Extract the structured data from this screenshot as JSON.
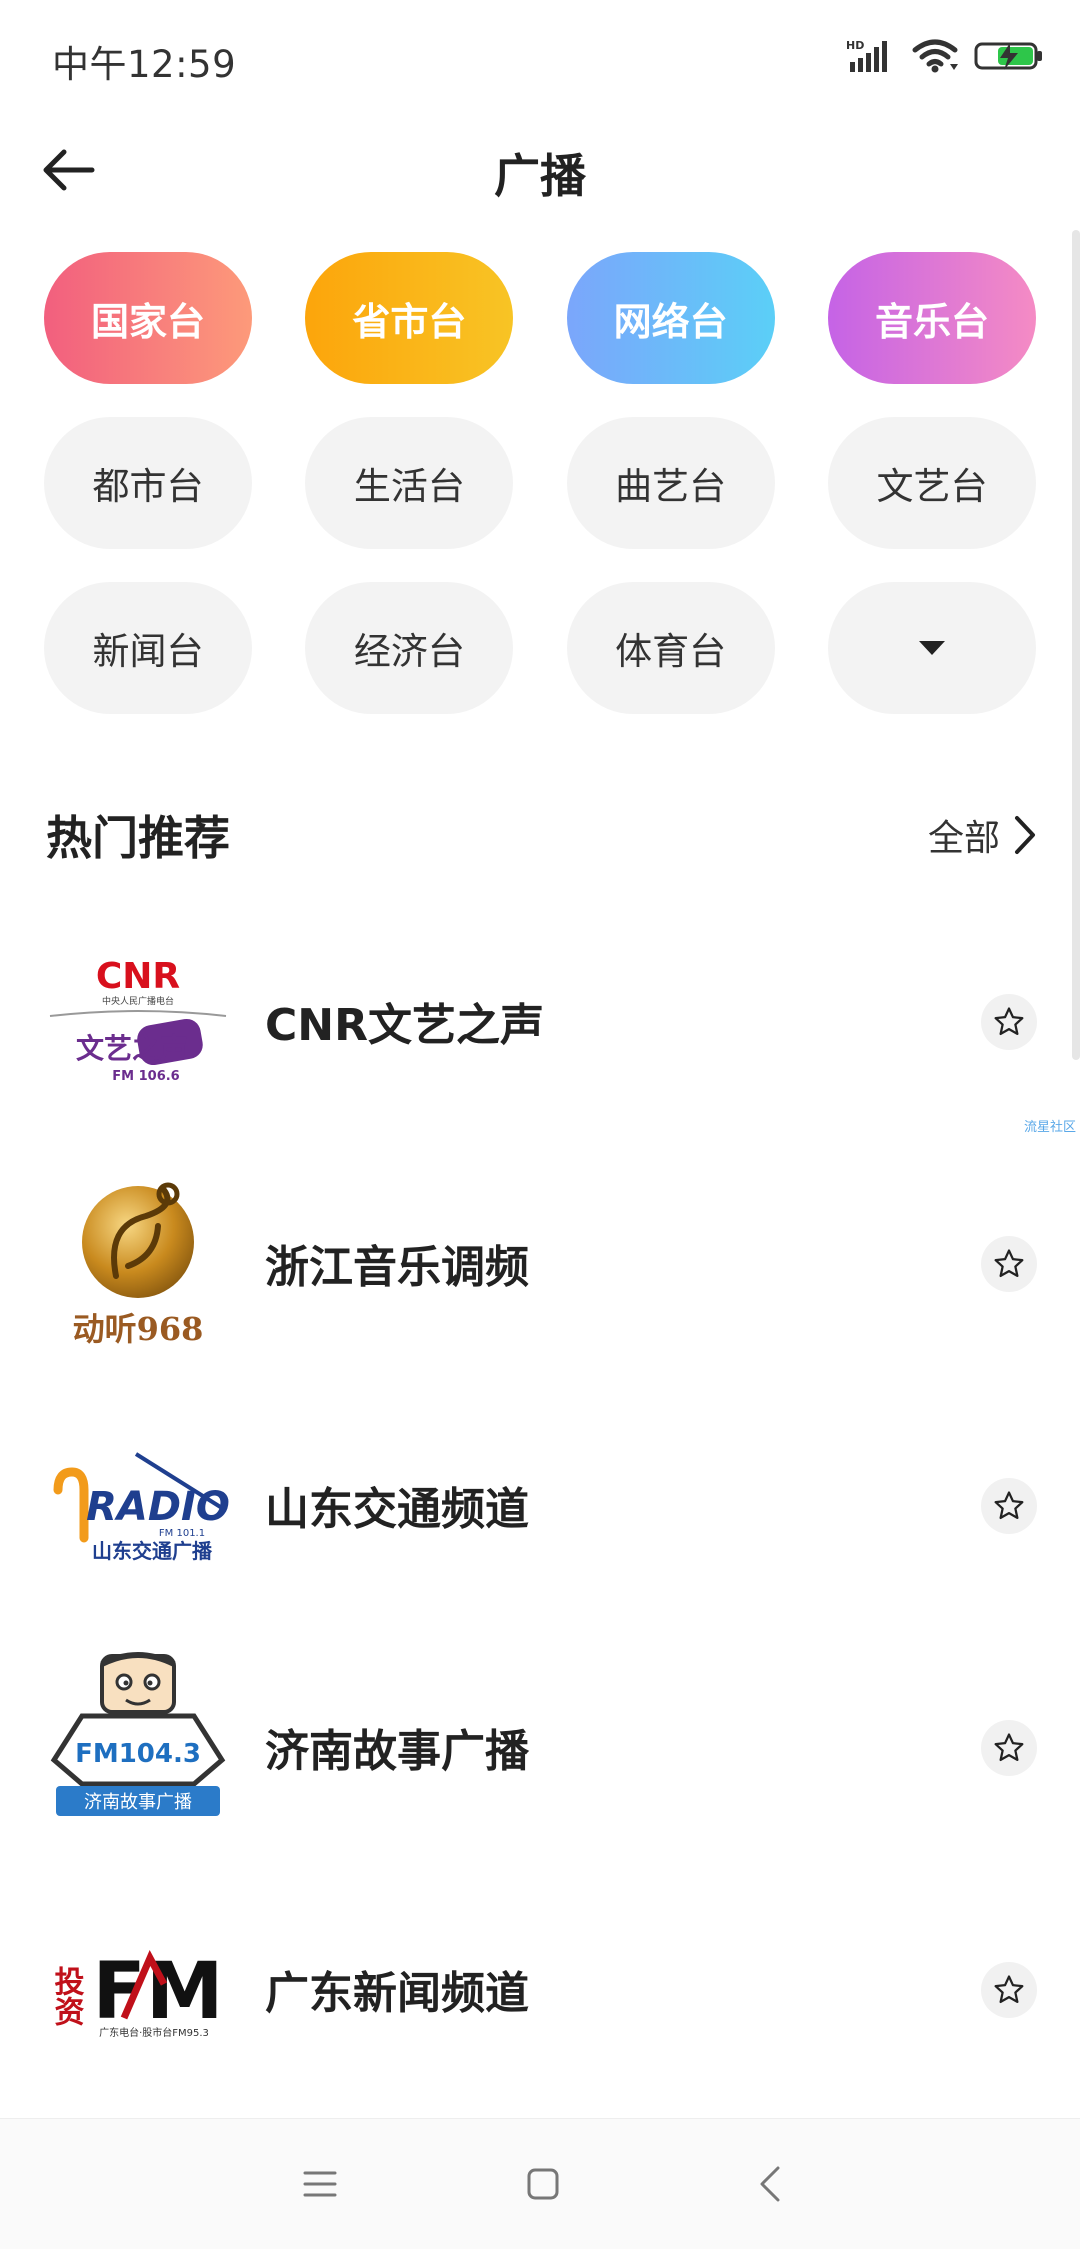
{
  "status_bar": {
    "time": "中午12:59",
    "network_label": "HD"
  },
  "header": {
    "title": "广播"
  },
  "categories": {
    "featured": [
      "国家台",
      "省市台",
      "网络台",
      "音乐台"
    ],
    "row2": [
      "都市台",
      "生活台",
      "曲艺台",
      "文艺台"
    ],
    "row3": [
      "新闻台",
      "经济台",
      "体育台"
    ]
  },
  "hot": {
    "title": "热门推荐",
    "see_all": "全部",
    "stations": [
      {
        "name": "CNR文艺之声",
        "logo_top": "CNR",
        "logo_sub": "中央人民广播电台",
        "logo_brand": "文艺之声",
        "logo_freq": "FM 106.6"
      },
      {
        "name": "浙江音乐调频",
        "logo_brand": "动听968"
      },
      {
        "name": "山东交通频道",
        "logo_top": "RADIO",
        "logo_freq": "FM 101.1",
        "logo_sub": "山东交通广播"
      },
      {
        "name": "济南故事广播",
        "logo_freq": "FM104.3",
        "logo_sub": "济南故事广播"
      },
      {
        "name": "广东新闻频道",
        "logo_top": "投资",
        "logo_brand": "FM",
        "logo_sub": "广东电台·股市台FM95.3"
      }
    ]
  },
  "watermark": "流星社区",
  "colors": {
    "featured_0": "#f25f7e",
    "featured_1": "#fca50b",
    "featured_2": "#7ba6fb",
    "featured_3": "#c563e6"
  }
}
